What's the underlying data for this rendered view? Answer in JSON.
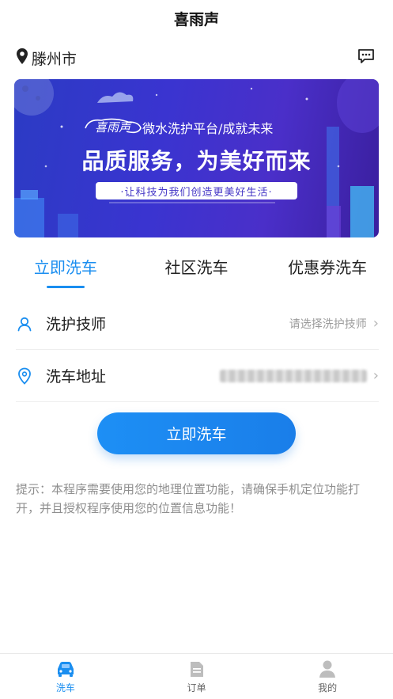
{
  "app": {
    "title": "喜雨声"
  },
  "location": {
    "city": "滕州市"
  },
  "banner": {
    "logo_text": "喜雨声",
    "subtitle": "微水洗护平台/成就未来",
    "headline": "品质服务，为美好而来",
    "slogan": "·让科技为我们创造更美好生活·"
  },
  "tabs": [
    {
      "label": "立即洗车",
      "active": true
    },
    {
      "label": "社区洗车",
      "active": false
    },
    {
      "label": "优惠券洗车",
      "active": false
    }
  ],
  "form": {
    "technician_label": "洗护技师",
    "technician_placeholder": "请选择洗护技师",
    "address_label": "洗车地址"
  },
  "wash_button": "立即洗车",
  "tip": "提示：本程序需要使用您的地理位置功能，请确保手机定位功能打开，并且授权程序使用您的位置信息功能！",
  "bottom_nav": [
    {
      "label": "洗车",
      "icon": "car-icon",
      "active": true
    },
    {
      "label": "订单",
      "icon": "order-icon",
      "active": false
    },
    {
      "label": "我的",
      "icon": "user-icon",
      "active": false
    }
  ],
  "colors": {
    "accent": "#1a8ef0",
    "banner_bg": "#3a34d0",
    "text_muted": "#9a9a9a"
  }
}
